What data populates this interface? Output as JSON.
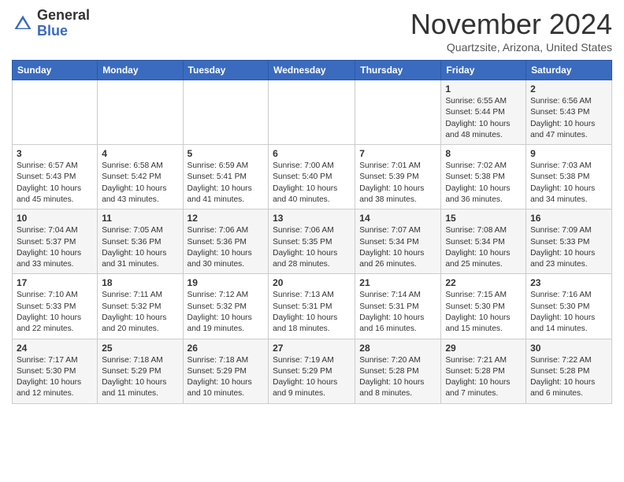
{
  "logo": {
    "general": "General",
    "blue": "Blue"
  },
  "header": {
    "month": "November 2024",
    "location": "Quartzsite, Arizona, United States"
  },
  "weekdays": [
    "Sunday",
    "Monday",
    "Tuesday",
    "Wednesday",
    "Thursday",
    "Friday",
    "Saturday"
  ],
  "weeks": [
    [
      {
        "day": "",
        "info": ""
      },
      {
        "day": "",
        "info": ""
      },
      {
        "day": "",
        "info": ""
      },
      {
        "day": "",
        "info": ""
      },
      {
        "day": "",
        "info": ""
      },
      {
        "day": "1",
        "info": "Sunrise: 6:55 AM\nSunset: 5:44 PM\nDaylight: 10 hours\nand 48 minutes."
      },
      {
        "day": "2",
        "info": "Sunrise: 6:56 AM\nSunset: 5:43 PM\nDaylight: 10 hours\nand 47 minutes."
      }
    ],
    [
      {
        "day": "3",
        "info": "Sunrise: 6:57 AM\nSunset: 5:43 PM\nDaylight: 10 hours\nand 45 minutes."
      },
      {
        "day": "4",
        "info": "Sunrise: 6:58 AM\nSunset: 5:42 PM\nDaylight: 10 hours\nand 43 minutes."
      },
      {
        "day": "5",
        "info": "Sunrise: 6:59 AM\nSunset: 5:41 PM\nDaylight: 10 hours\nand 41 minutes."
      },
      {
        "day": "6",
        "info": "Sunrise: 7:00 AM\nSunset: 5:40 PM\nDaylight: 10 hours\nand 40 minutes."
      },
      {
        "day": "7",
        "info": "Sunrise: 7:01 AM\nSunset: 5:39 PM\nDaylight: 10 hours\nand 38 minutes."
      },
      {
        "day": "8",
        "info": "Sunrise: 7:02 AM\nSunset: 5:38 PM\nDaylight: 10 hours\nand 36 minutes."
      },
      {
        "day": "9",
        "info": "Sunrise: 7:03 AM\nSunset: 5:38 PM\nDaylight: 10 hours\nand 34 minutes."
      }
    ],
    [
      {
        "day": "10",
        "info": "Sunrise: 7:04 AM\nSunset: 5:37 PM\nDaylight: 10 hours\nand 33 minutes."
      },
      {
        "day": "11",
        "info": "Sunrise: 7:05 AM\nSunset: 5:36 PM\nDaylight: 10 hours\nand 31 minutes."
      },
      {
        "day": "12",
        "info": "Sunrise: 7:06 AM\nSunset: 5:36 PM\nDaylight: 10 hours\nand 30 minutes."
      },
      {
        "day": "13",
        "info": "Sunrise: 7:06 AM\nSunset: 5:35 PM\nDaylight: 10 hours\nand 28 minutes."
      },
      {
        "day": "14",
        "info": "Sunrise: 7:07 AM\nSunset: 5:34 PM\nDaylight: 10 hours\nand 26 minutes."
      },
      {
        "day": "15",
        "info": "Sunrise: 7:08 AM\nSunset: 5:34 PM\nDaylight: 10 hours\nand 25 minutes."
      },
      {
        "day": "16",
        "info": "Sunrise: 7:09 AM\nSunset: 5:33 PM\nDaylight: 10 hours\nand 23 minutes."
      }
    ],
    [
      {
        "day": "17",
        "info": "Sunrise: 7:10 AM\nSunset: 5:33 PM\nDaylight: 10 hours\nand 22 minutes."
      },
      {
        "day": "18",
        "info": "Sunrise: 7:11 AM\nSunset: 5:32 PM\nDaylight: 10 hours\nand 20 minutes."
      },
      {
        "day": "19",
        "info": "Sunrise: 7:12 AM\nSunset: 5:32 PM\nDaylight: 10 hours\nand 19 minutes."
      },
      {
        "day": "20",
        "info": "Sunrise: 7:13 AM\nSunset: 5:31 PM\nDaylight: 10 hours\nand 18 minutes."
      },
      {
        "day": "21",
        "info": "Sunrise: 7:14 AM\nSunset: 5:31 PM\nDaylight: 10 hours\nand 16 minutes."
      },
      {
        "day": "22",
        "info": "Sunrise: 7:15 AM\nSunset: 5:30 PM\nDaylight: 10 hours\nand 15 minutes."
      },
      {
        "day": "23",
        "info": "Sunrise: 7:16 AM\nSunset: 5:30 PM\nDaylight: 10 hours\nand 14 minutes."
      }
    ],
    [
      {
        "day": "24",
        "info": "Sunrise: 7:17 AM\nSunset: 5:30 PM\nDaylight: 10 hours\nand 12 minutes."
      },
      {
        "day": "25",
        "info": "Sunrise: 7:18 AM\nSunset: 5:29 PM\nDaylight: 10 hours\nand 11 minutes."
      },
      {
        "day": "26",
        "info": "Sunrise: 7:18 AM\nSunset: 5:29 PM\nDaylight: 10 hours\nand 10 minutes."
      },
      {
        "day": "27",
        "info": "Sunrise: 7:19 AM\nSunset: 5:29 PM\nDaylight: 10 hours\nand 9 minutes."
      },
      {
        "day": "28",
        "info": "Sunrise: 7:20 AM\nSunset: 5:28 PM\nDaylight: 10 hours\nand 8 minutes."
      },
      {
        "day": "29",
        "info": "Sunrise: 7:21 AM\nSunset: 5:28 PM\nDaylight: 10 hours\nand 7 minutes."
      },
      {
        "day": "30",
        "info": "Sunrise: 7:22 AM\nSunset: 5:28 PM\nDaylight: 10 hours\nand 6 minutes."
      }
    ]
  ]
}
